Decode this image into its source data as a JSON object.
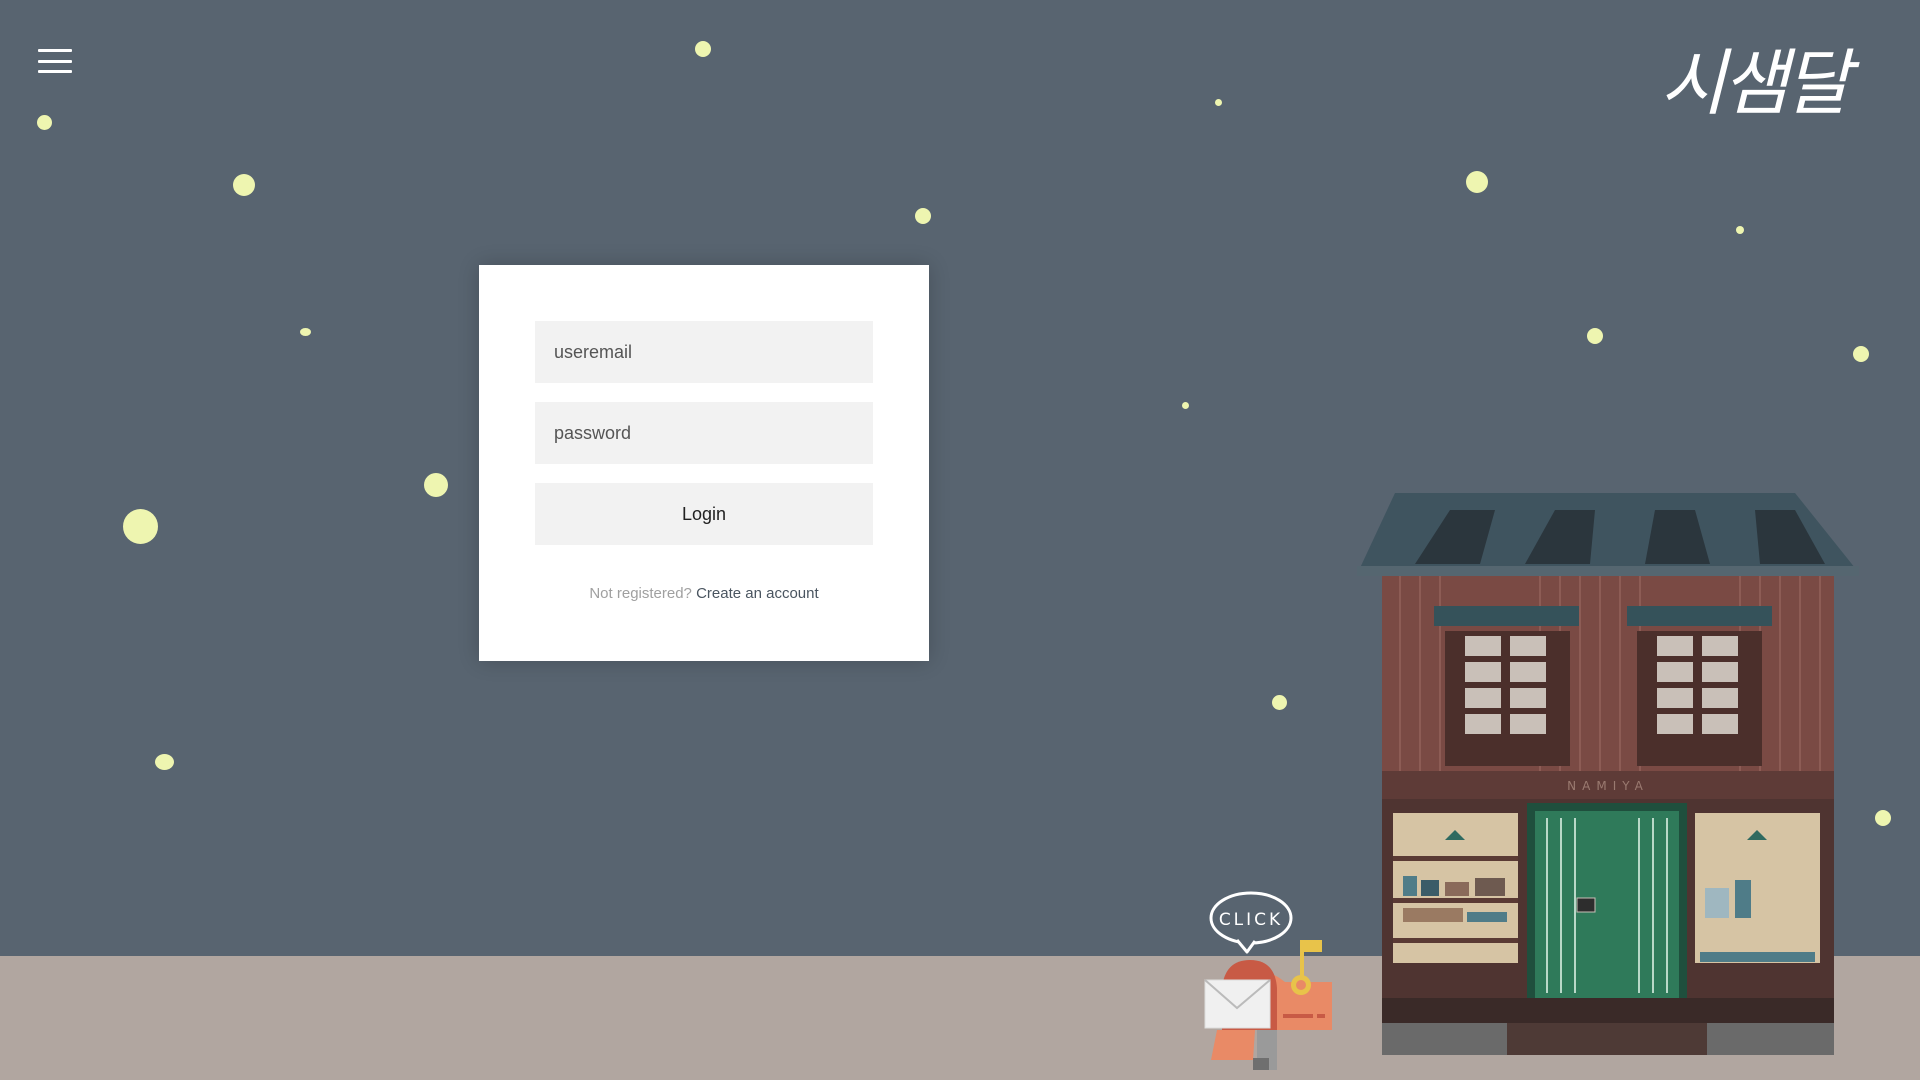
{
  "header": {
    "menu_icon": "hamburger-menu-icon",
    "logo_text": "시샘달"
  },
  "login_form": {
    "email_placeholder": "useremail",
    "password_placeholder": "password",
    "login_label": "Login",
    "not_registered": "Not registered?",
    "create_account": "Create an account"
  },
  "scene": {
    "shop_sign": "NAMIYA",
    "mailbox_bubble": "CLICK",
    "colors": {
      "sky": "#586470",
      "ground": "#b1a6a0",
      "star": "#eef5b0",
      "shop_wall": "#7a4a44",
      "shop_door": "#2f7a5a",
      "mailbox": "#e98a66"
    }
  }
}
